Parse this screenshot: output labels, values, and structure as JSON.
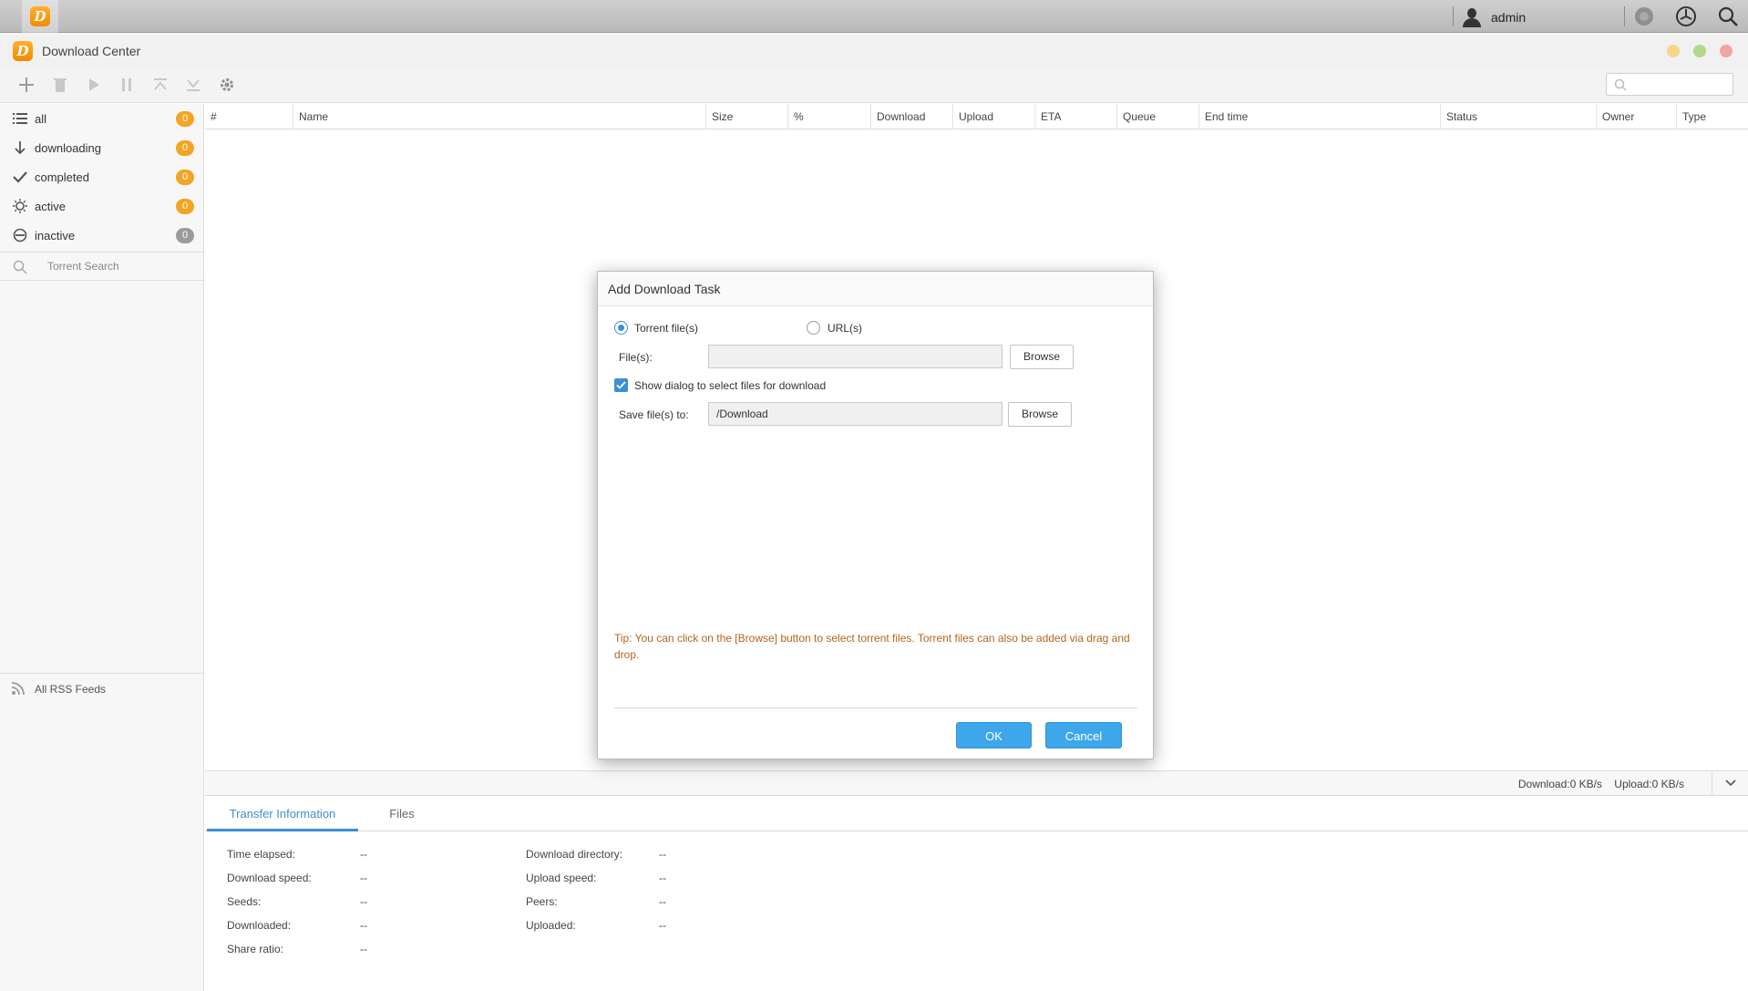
{
  "taskbar": {
    "user_name": "admin"
  },
  "window": {
    "title": "Download Center"
  },
  "colors": {
    "accent": "#3c8fd6",
    "badge": "#f3a523",
    "tip": "#b5651d",
    "primary_button": "#3ea6ea"
  },
  "toolbar": {
    "icons": [
      "add-icon",
      "delete-icon",
      "play-icon",
      "pause-icon",
      "move-top-icon",
      "move-bottom-icon",
      "settings-icon"
    ],
    "search_placeholder": ""
  },
  "sidebar": {
    "items": [
      {
        "label": "all",
        "count": "0",
        "icon": "list-icon"
      },
      {
        "label": "downloading",
        "count": "0",
        "icon": "arrow-down-icon"
      },
      {
        "label": "completed",
        "count": "0",
        "icon": "check-icon"
      },
      {
        "label": "active",
        "count": "0",
        "icon": "sun-icon"
      },
      {
        "label": "inactive",
        "count": "0",
        "icon": "minus-circle-icon"
      }
    ],
    "search_label": "Torrent Search",
    "rss_label": "All RSS Feeds"
  },
  "table": {
    "columns": [
      "#",
      "Name",
      "Size",
      "%",
      "Download",
      "Upload",
      "ETA",
      "Queue",
      "End time",
      "Status",
      "Owner",
      "Type"
    ]
  },
  "statusbar": {
    "download": "Download:0 KB/s",
    "upload": "Upload:0 KB/s"
  },
  "bottom": {
    "tabs": [
      "Transfer Information",
      "Files"
    ],
    "left": [
      {
        "label": "Time elapsed:",
        "value": "--"
      },
      {
        "label": "Download speed:",
        "value": "--"
      },
      {
        "label": "Seeds:",
        "value": "--"
      },
      {
        "label": "Downloaded:",
        "value": "--"
      },
      {
        "label": "Share ratio:",
        "value": "--"
      }
    ],
    "right": [
      {
        "label": "Download directory:",
        "value": "--"
      },
      {
        "label": "Upload speed:",
        "value": "--"
      },
      {
        "label": "Peers:",
        "value": "--"
      },
      {
        "label": "Uploaded:",
        "value": "--"
      }
    ]
  },
  "dialog": {
    "title": "Add Download Task",
    "radio_torrent": "Torrent file(s)",
    "radio_url": "URL(s)",
    "files_label": "File(s):",
    "files_value": "",
    "browse_label": "Browse",
    "show_dialog_label": "Show dialog to select files for download",
    "save_label": "Save file(s) to:",
    "save_value": "/Download",
    "tip": "Tip: You can click on the [Browse] button to select torrent files. Torrent files can also be added via drag and drop.",
    "ok_label": "OK",
    "cancel_label": "Cancel"
  }
}
